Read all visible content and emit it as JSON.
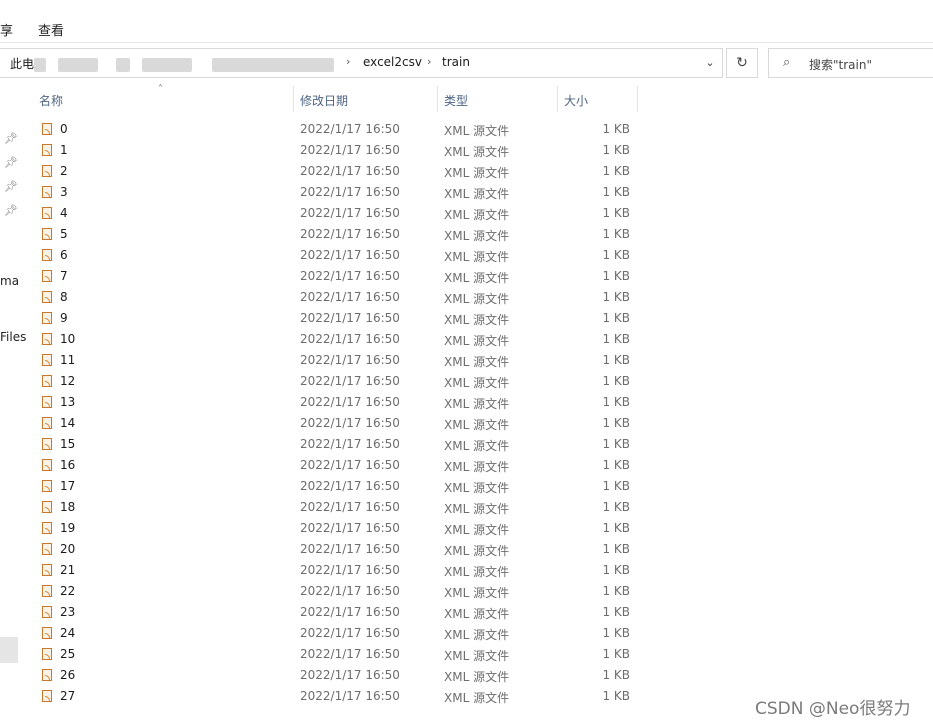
{
  "ribbon": {
    "tab_share": "享",
    "tab_view": "查看"
  },
  "address": {
    "root": "此电",
    "segments": [
      "excel2csv",
      "train"
    ],
    "separator": "›"
  },
  "search": {
    "placeholder": "搜索\"train\"",
    "icon": "search-icon"
  },
  "nav": {
    "label_1": "ma",
    "label_2": "Files"
  },
  "columns": {
    "name": "名称",
    "date": "修改日期",
    "type": "类型",
    "size": "大小"
  },
  "files": [
    {
      "name": "0",
      "date": "2022/1/17 16:50",
      "type": "XML 源文件",
      "size": "1 KB"
    },
    {
      "name": "1",
      "date": "2022/1/17 16:50",
      "type": "XML 源文件",
      "size": "1 KB"
    },
    {
      "name": "2",
      "date": "2022/1/17 16:50",
      "type": "XML 源文件",
      "size": "1 KB"
    },
    {
      "name": "3",
      "date": "2022/1/17 16:50",
      "type": "XML 源文件",
      "size": "1 KB"
    },
    {
      "name": "4",
      "date": "2022/1/17 16:50",
      "type": "XML 源文件",
      "size": "1 KB"
    },
    {
      "name": "5",
      "date": "2022/1/17 16:50",
      "type": "XML 源文件",
      "size": "1 KB"
    },
    {
      "name": "6",
      "date": "2022/1/17 16:50",
      "type": "XML 源文件",
      "size": "1 KB"
    },
    {
      "name": "7",
      "date": "2022/1/17 16:50",
      "type": "XML 源文件",
      "size": "1 KB"
    },
    {
      "name": "8",
      "date": "2022/1/17 16:50",
      "type": "XML 源文件",
      "size": "1 KB"
    },
    {
      "name": "9",
      "date": "2022/1/17 16:50",
      "type": "XML 源文件",
      "size": "1 KB"
    },
    {
      "name": "10",
      "date": "2022/1/17 16:50",
      "type": "XML 源文件",
      "size": "1 KB"
    },
    {
      "name": "11",
      "date": "2022/1/17 16:50",
      "type": "XML 源文件",
      "size": "1 KB"
    },
    {
      "name": "12",
      "date": "2022/1/17 16:50",
      "type": "XML 源文件",
      "size": "1 KB"
    },
    {
      "name": "13",
      "date": "2022/1/17 16:50",
      "type": "XML 源文件",
      "size": "1 KB"
    },
    {
      "name": "14",
      "date": "2022/1/17 16:50",
      "type": "XML 源文件",
      "size": "1 KB"
    },
    {
      "name": "15",
      "date": "2022/1/17 16:50",
      "type": "XML 源文件",
      "size": "1 KB"
    },
    {
      "name": "16",
      "date": "2022/1/17 16:50",
      "type": "XML 源文件",
      "size": "1 KB"
    },
    {
      "name": "17",
      "date": "2022/1/17 16:50",
      "type": "XML 源文件",
      "size": "1 KB"
    },
    {
      "name": "18",
      "date": "2022/1/17 16:50",
      "type": "XML 源文件",
      "size": "1 KB"
    },
    {
      "name": "19",
      "date": "2022/1/17 16:50",
      "type": "XML 源文件",
      "size": "1 KB"
    },
    {
      "name": "20",
      "date": "2022/1/17 16:50",
      "type": "XML 源文件",
      "size": "1 KB"
    },
    {
      "name": "21",
      "date": "2022/1/17 16:50",
      "type": "XML 源文件",
      "size": "1 KB"
    },
    {
      "name": "22",
      "date": "2022/1/17 16:50",
      "type": "XML 源文件",
      "size": "1 KB"
    },
    {
      "name": "23",
      "date": "2022/1/17 16:50",
      "type": "XML 源文件",
      "size": "1 KB"
    },
    {
      "name": "24",
      "date": "2022/1/17 16:50",
      "type": "XML 源文件",
      "size": "1 KB"
    },
    {
      "name": "25",
      "date": "2022/1/17 16:50",
      "type": "XML 源文件",
      "size": "1 KB"
    },
    {
      "name": "26",
      "date": "2022/1/17 16:50",
      "type": "XML 源文件",
      "size": "1 KB"
    },
    {
      "name": "27",
      "date": "2022/1/17 16:50",
      "type": "XML 源文件",
      "size": "1 KB"
    }
  ],
  "watermark": "CSDN @Neo很努力",
  "colors": {
    "header_text": "#4d6482",
    "file_icon": "#d9822b",
    "meta_text": "#6d6d6d"
  }
}
